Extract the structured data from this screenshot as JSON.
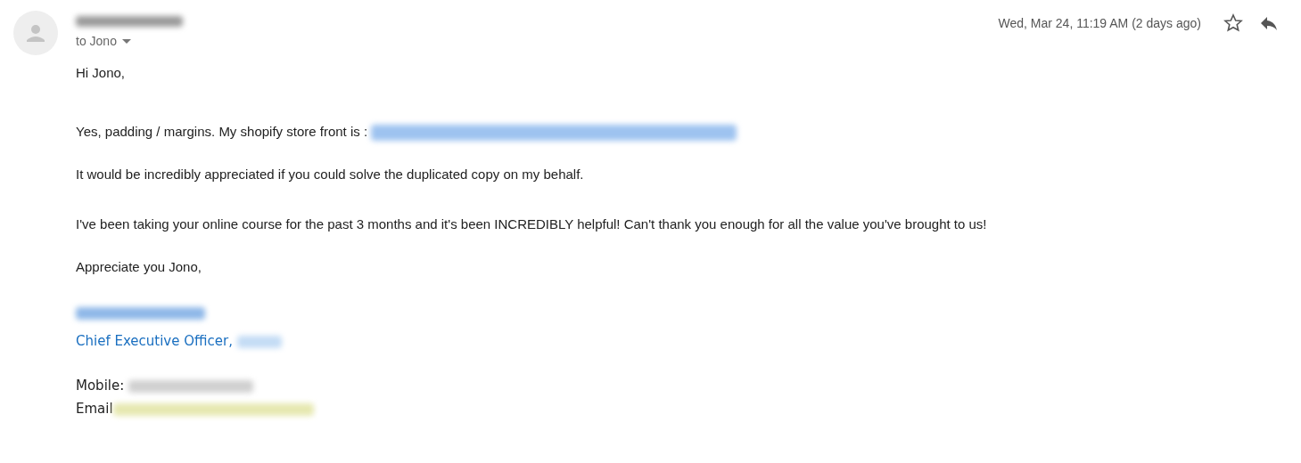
{
  "header": {
    "sender": {
      "kind": "redacted",
      "color": "#9a9a9a"
    },
    "recipient": "to Jono",
    "date": "Wed, Mar 24, 11:19 AM (2 days ago)",
    "starred": false
  },
  "body": [
    {
      "parts": [
        {
          "kind": "text",
          "text": "Hi Jono,"
        }
      ]
    },
    {
      "parts": [
        {
          "kind": "text",
          "text": "Yes, padding / margins. My shopify store front is : "
        },
        {
          "kind": "redacted",
          "color": "#9ec3f0"
        }
      ]
    },
    {
      "parts": [
        {
          "kind": "text",
          "text": "It would be incredibly appreciated if you could solve the duplicated copy on my behalf."
        }
      ]
    },
    {
      "parts": [
        {
          "kind": "text",
          "text": "I've been taking your online course for the past 3 months and it's been INCREDIBLY helpful! Can't thank you enough for all the value you've brought to us!"
        }
      ]
    },
    {
      "parts": [
        {
          "kind": "text",
          "text": "Appreciate you Jono,"
        }
      ]
    }
  ],
  "signature": [
    {
      "kind": "line",
      "parts": [
        {
          "kind": "redacted",
          "color": "#8fb8e8"
        }
      ]
    },
    {
      "kind": "title",
      "parts": [
        {
          "kind": "text",
          "text": "Chief Executive Officer, "
        },
        {
          "kind": "redacted",
          "color": "#c4dcf5"
        }
      ]
    },
    {
      "kind": "line",
      "parts": [
        {
          "kind": "text",
          "text": "Mobile: "
        },
        {
          "kind": "redacted",
          "color": "#d0d0d0"
        }
      ]
    },
    {
      "kind": "line",
      "parts": [
        {
          "kind": "text",
          "text": "Email"
        },
        {
          "kind": "redacted",
          "color": "#e6e8b0"
        }
      ]
    }
  ]
}
